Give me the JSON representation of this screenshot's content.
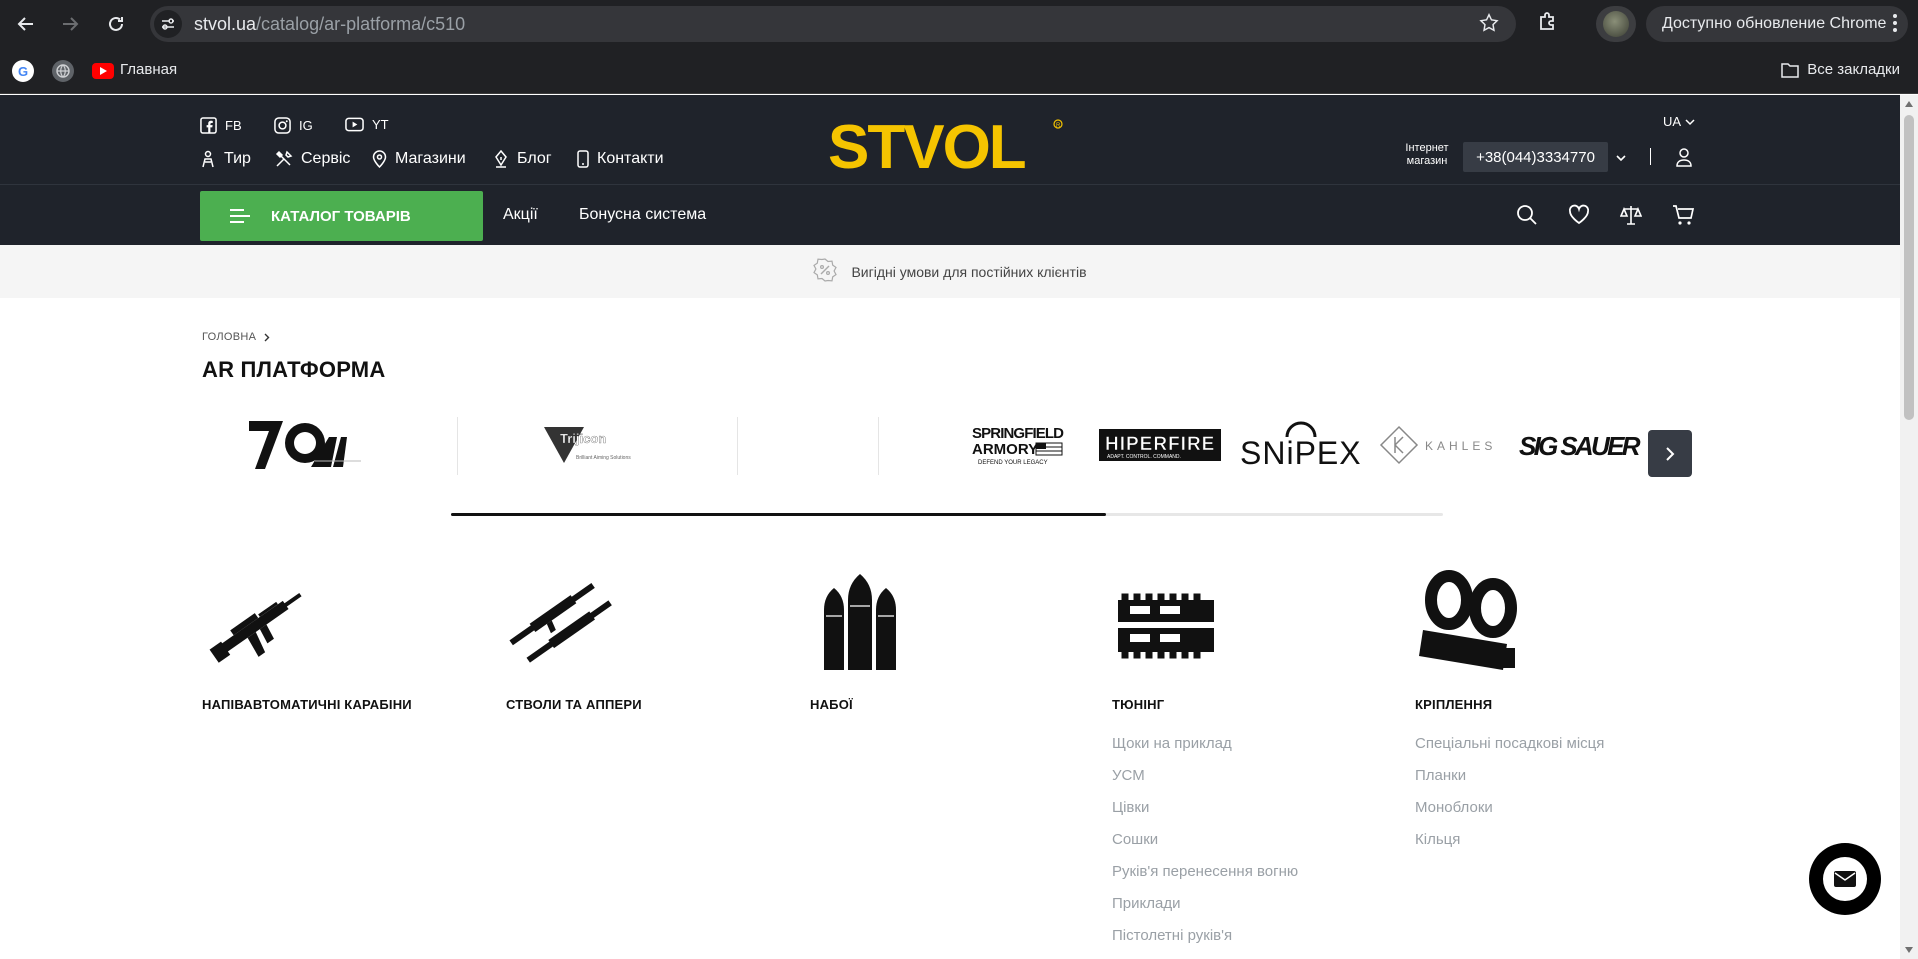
{
  "browser": {
    "url_host": "stvol.ua",
    "url_path": "/catalog/ar-platforma/c510",
    "update_label": "Доступно обновление Chrome",
    "bookmarks": {
      "main": "Главная",
      "all": "Все закладки"
    }
  },
  "header": {
    "social": [
      {
        "label": "FB",
        "icon": "facebook-icon"
      },
      {
        "label": "IG",
        "icon": "instagram-icon"
      },
      {
        "label": "YT",
        "icon": "youtube-icon"
      }
    ],
    "nav": [
      {
        "label": "Тир",
        "icon": "target-icon"
      },
      {
        "label": "Сервіс",
        "icon": "tools-icon"
      },
      {
        "label": "Магазини",
        "icon": "location-icon"
      },
      {
        "label": "Блог",
        "icon": "pen-icon"
      },
      {
        "label": "Контакти",
        "icon": "phone-icon"
      }
    ],
    "logo_text": "STVOL",
    "lang": "UA",
    "shop_label": "Інтернет магазин",
    "phone": "+38(044)3334770",
    "catalog_button": "КАТАЛОГ ТОВАРІВ",
    "nav2": [
      "Акції",
      "Бонусна система"
    ],
    "accent": "#4caf50",
    "logo_color": "#f5c400"
  },
  "promo": {
    "text": "Вигідні умови для постійних клієнтів"
  },
  "breadcrumb": {
    "home": "ГОЛОВНА"
  },
  "page_title": "AR ПЛАТФОРМА",
  "brands": {
    "trijicon": "Trijicon",
    "trijicon_tag": "Brilliant Aiming Solutions",
    "springfield_1": "SPRINGFIELD",
    "springfield_2": "ARMORY",
    "springfield_3": "DEFEND YOUR LEGACY",
    "hiperfire": "HIPERFIRE",
    "hiperfire_tag": "ADAPT. CONTROL. COMMAND.",
    "snipex": "SNiPEX",
    "kahles": "KAHLES",
    "sigsauer": "SIG SAUER",
    "slider_progress": 0.66
  },
  "categories": [
    {
      "title": "НАПІВАВТОМАТИЧНІ КАРАБІНИ",
      "icon": "rifle-icon",
      "links": []
    },
    {
      "title": "СТВОЛИ ТА АППЕРИ",
      "icon": "barrels-icon",
      "links": []
    },
    {
      "title": "НАБОЇ",
      "icon": "ammo-icon",
      "links": []
    },
    {
      "title": "ТЮНІНГ",
      "icon": "handguard-icon",
      "links": [
        "Щоки на приклад",
        "УСМ",
        "Цівки",
        "Сошки",
        "Руків'я перенесення вогню",
        "Приклади",
        "Пістолетні руків'я"
      ]
    },
    {
      "title": "КРІПЛЕННЯ",
      "icon": "scope-mount-icon",
      "links": [
        "Спеціальні посадкові місця",
        "Планки",
        "Моноблоки",
        "Кільця"
      ]
    }
  ]
}
